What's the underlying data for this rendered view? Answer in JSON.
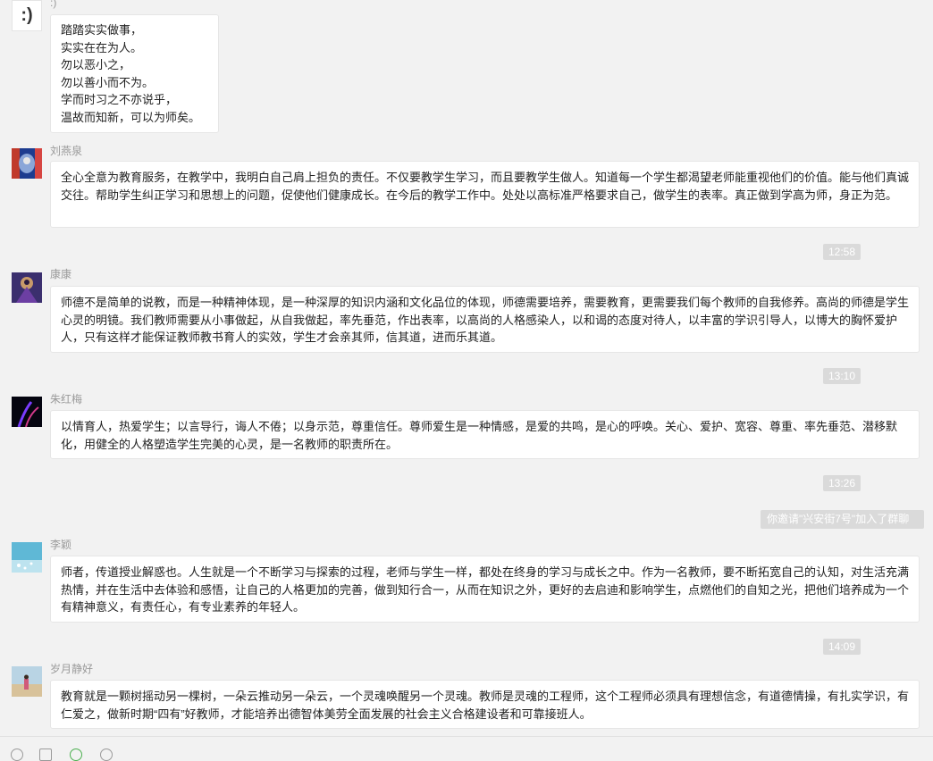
{
  "messages": [
    {
      "name": ":)",
      "avatar_text": ":)",
      "text": "踏踏实实做事，\n实实在在为人。\n勿以恶小之，\n勿以善小而不为。\n学而时习之不亦说乎，\n温故而知新，可以为师矣。"
    },
    {
      "name": "刘燕泉",
      "text": "全心全意为教育服务，在教学中，我明白自己肩上担负的责任。不仅要教学生学习，而且要教学生做人。知道每一个学生都渴望老师能重视他们的价值。能与他们真诚交往。帮助学生纠正学习和思想上的问题，促使他们健康成长。在今后的教学工作中。处处以高标准严格要求自己，做学生的表率。真正做到学高为师，身正为范。"
    },
    {
      "name": "康康",
      "text": "师德不是简单的说教，而是一种精神体现，是一种深厚的知识内涵和文化品位的体现，师德需要培养，需要教育，更需要我们每个教师的自我修养。高尚的师德是学生心灵的明镜。我们教师需要从小事做起，从自我做起，率先垂范，作出表率，以高尚的人格感染人，以和谒的态度对待人，以丰富的学识引导人，以博大的胸怀爱护人，只有这样才能保证教师教书育人的实效，学生才会亲其师，信其道，进而乐其道。"
    },
    {
      "name": "朱红梅",
      "text": "以情育人，热爱学生；以言导行，诲人不倦；以身示范，尊重信任。尊师爱生是一种情感，是爱的共鸣，是心的呼唤。关心、爱护、宽容、尊重、率先垂范、潜移默化，用健全的人格塑造学生完美的心灵，是一名教师的职责所在。"
    },
    {
      "name": "李颖",
      "text": "师者，传道授业解惑也。人生就是一个不断学习与探索的过程，老师与学生一样，都处在终身的学习与成长之中。作为一名教师，要不断拓宽自己的认知，对生活充满热情，并在生活中去体验和感悟，让自己的人格更加的完善，做到知行合一，从而在知识之外，更好的去启迪和影响学生，点燃他们的自知之光，把他们培养成为一个有精神意义，有责任心，有专业素养的年轻人。"
    },
    {
      "name": "岁月静好",
      "text": "教育就是一颗树摇动另一棵树，一朵云推动另一朵云，一个灵魂唤醒另一个灵魂。教师是灵魂的工程师，这个工程师必须具有理想信念，有道德情操，有扎实学识，有仁爱之，做新时期“四有”好教师，才能培养出德智体美劳全面发展的社会主义合格建设者和可靠接班人。"
    }
  ],
  "times": [
    "12:58",
    "13:10",
    "13:26",
    "14:09"
  ],
  "system_notice": "你邀请\"兴安街7号\"加入了群聊",
  "colors": {
    "background": "#f2f2f2",
    "bubble": "#ffffff",
    "time_badge": "#dadada",
    "name": "#9a9a9a"
  }
}
